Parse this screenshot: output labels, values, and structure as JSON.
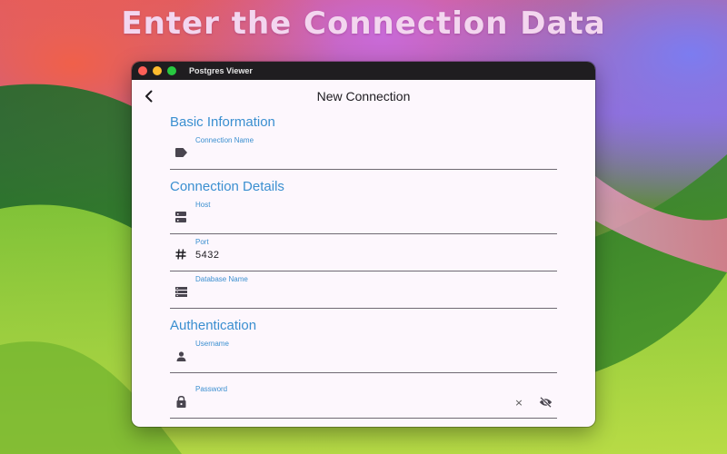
{
  "promo": {
    "headline": "Enter the Connection Data"
  },
  "window": {
    "title": "Postgres Viewer"
  },
  "appbar": {
    "title": "New Connection",
    "back_icon": "chevron-left-icon"
  },
  "sections": {
    "basic": {
      "title": "Basic Information",
      "connection_name": {
        "label": "Connection Name",
        "value": "",
        "icon": "label-tag-icon"
      }
    },
    "details": {
      "title": "Connection Details",
      "host": {
        "label": "Host",
        "value": "",
        "icon": "server-icon"
      },
      "port": {
        "label": "Port",
        "value": "5432",
        "icon": "hash-icon"
      },
      "database": {
        "label": "Database Name",
        "value": "",
        "icon": "database-icon"
      }
    },
    "auth": {
      "title": "Authentication",
      "username": {
        "label": "Username",
        "value": "",
        "icon": "person-icon"
      },
      "password": {
        "label": "Password",
        "value": "",
        "icon": "lock-icon",
        "clear_icon": "clear-icon",
        "visibility_icon": "visibility-off-icon"
      }
    }
  },
  "colors": {
    "accent": "#3a8fd0",
    "window_bg": "#fdf7fd",
    "titlebar": "#1f1d20"
  }
}
